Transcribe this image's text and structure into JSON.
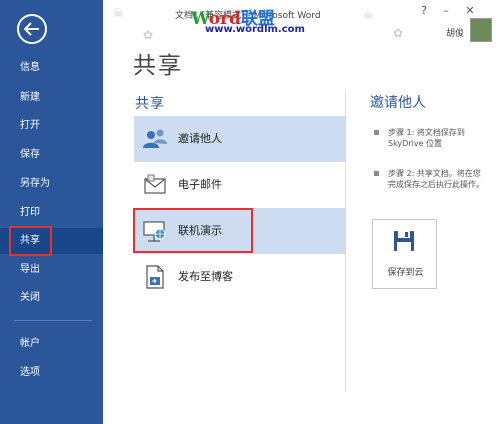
{
  "window": {
    "title": "文档1 [兼容模式] - Microsoft Word",
    "user_name": "胡俊",
    "minimize": "–",
    "close": "✕",
    "help": "?"
  },
  "watermark": {
    "w": "W",
    "ord": "ord",
    "lm": "联盟",
    "url": "www.wordlm.com"
  },
  "sidebar": {
    "items": [
      {
        "label": "信息"
      },
      {
        "label": "新建"
      },
      {
        "label": "打开"
      },
      {
        "label": "保存"
      },
      {
        "label": "另存为"
      },
      {
        "label": "打印"
      },
      {
        "label": "共享"
      },
      {
        "label": "导出"
      },
      {
        "label": "关闭"
      },
      {
        "label": "帐户"
      },
      {
        "label": "选项"
      }
    ],
    "active": "共享"
  },
  "main": {
    "page_title": "共享",
    "section_title": "共享",
    "share_options": [
      {
        "label": "邀请他人",
        "icon": "people-icon"
      },
      {
        "label": "电子邮件",
        "icon": "email-icon"
      },
      {
        "label": "联机演示",
        "icon": "online-present-icon"
      },
      {
        "label": "发布至博客",
        "icon": "blog-icon"
      }
    ]
  },
  "right_panel": {
    "title": "邀请他人",
    "steps": [
      "步骤 1: 将文档保存到 SkyDrive 位置",
      "步骤 2: 共享文档。将在您完成保存之后执行此操作。"
    ],
    "save_button": "保存到云"
  },
  "colors": {
    "sidebar": "#2b579a",
    "accent": "#2b579a",
    "highlight_box": "#e23232",
    "selected_row": "#cddcf0"
  }
}
